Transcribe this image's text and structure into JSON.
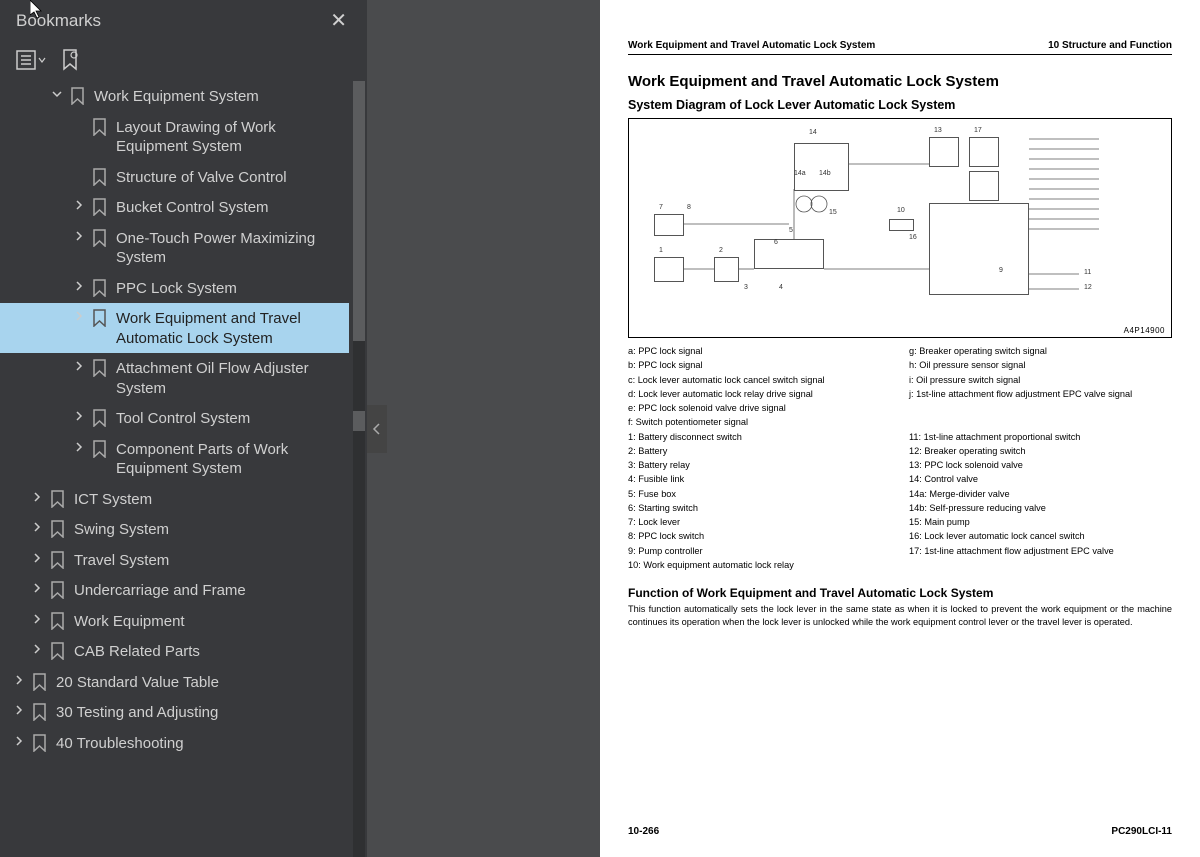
{
  "sidebar": {
    "title": "Bookmarks",
    "items": [
      {
        "level": 2,
        "chev": "down",
        "label": "Work Equipment System"
      },
      {
        "level": 3,
        "chev": "",
        "label": "Layout Drawing of Work Equipment System"
      },
      {
        "level": 3,
        "chev": "",
        "label": "Structure of Valve Control"
      },
      {
        "level": 3,
        "chev": "right",
        "label": "Bucket Control System"
      },
      {
        "level": 3,
        "chev": "right",
        "label": "One-Touch Power Maximizing System"
      },
      {
        "level": 3,
        "chev": "right",
        "label": "PPC Lock System"
      },
      {
        "level": 3,
        "chev": "right",
        "label": "Work Equipment and Travel Automatic Lock System",
        "selected": true
      },
      {
        "level": 3,
        "chev": "right",
        "label": "Attachment Oil Flow Adjuster System"
      },
      {
        "level": 3,
        "chev": "right",
        "label": "Tool Control System"
      },
      {
        "level": 3,
        "chev": "right",
        "label": "Component Parts of Work Equipment System"
      },
      {
        "level": 1,
        "chev": "right",
        "label": "ICT System"
      },
      {
        "level": 1,
        "chev": "right",
        "label": "Swing System"
      },
      {
        "level": 1,
        "chev": "right",
        "label": "Travel System"
      },
      {
        "level": 1,
        "chev": "right",
        "label": "Undercarriage and Frame"
      },
      {
        "level": 1,
        "chev": "right",
        "label": "Work Equipment"
      },
      {
        "level": 1,
        "chev": "right",
        "label": "CAB Related Parts"
      },
      {
        "level": 0,
        "chev": "right",
        "label": "20 Standard Value Table"
      },
      {
        "level": 0,
        "chev": "right",
        "label": "30 Testing and Adjusting"
      },
      {
        "level": 0,
        "chev": "right",
        "label": "40 Troubleshooting"
      }
    ]
  },
  "page": {
    "header_left": "Work Equipment and Travel Automatic Lock System",
    "header_right": "10 Structure and Function",
    "title": "Work Equipment and Travel Automatic Lock System",
    "subtitle": "System Diagram of Lock Lever Automatic Lock System",
    "diagram_ref": "A4P14900",
    "legend_left": [
      "a: PPC lock signal",
      "b: PPC lock signal",
      "c: Lock lever automatic lock cancel switch signal",
      "d: Lock lever automatic lock relay drive signal",
      "e: PPC lock solenoid valve drive signal",
      "f: Switch potentiometer signal",
      "1: Battery disconnect switch",
      "2: Battery",
      "3: Battery relay",
      "4: Fusible link",
      "5: Fuse box",
      "6: Starting switch",
      "7: Lock lever",
      "8: PPC lock switch",
      "9: Pump controller",
      "10: Work equipment automatic lock relay"
    ],
    "legend_right": [
      "g: Breaker operating switch signal",
      "h: Oil pressure sensor signal",
      "i: Oil pressure switch signal",
      "j: 1st-line attachment flow adjustment EPC valve signal",
      "",
      "",
      "11: 1st-line attachment proportional switch",
      "12: Breaker operating switch",
      "13: PPC lock solenoid valve",
      "14: Control valve",
      "14a: Merge-divider valve",
      "14b: Self-pressure reducing valve",
      "15: Main pump",
      "16: Lock lever automatic lock cancel switch",
      "17: 1st-line attachment flow adjustment EPC valve"
    ],
    "func_title": "Function of Work Equipment and Travel Automatic Lock System",
    "func_body": "This function automatically sets the lock lever in the same state as when it is locked to prevent the work equipment or the machine continues its operation when the lock lever is unlocked while the work equipment control lever or the travel lever is operated.",
    "footer_left": "10-266",
    "footer_right": "PC290LCI-11"
  },
  "diagram_labels": [
    "1",
    "2",
    "3",
    "4",
    "5",
    "6",
    "7",
    "8",
    "9",
    "10",
    "11",
    "12",
    "13",
    "14",
    "14a",
    "14b",
    "15",
    "16",
    "17"
  ]
}
